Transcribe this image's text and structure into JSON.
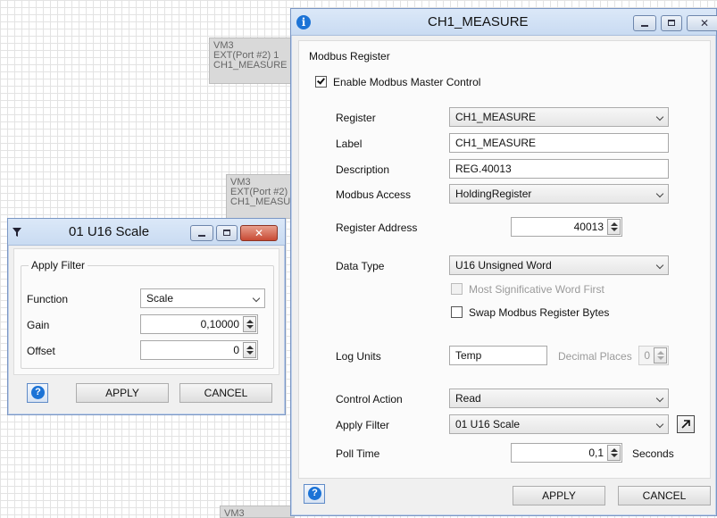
{
  "canvas": {
    "nodes": [
      {
        "lines": [
          "VM3",
          "EXT(Port #2) 1",
          "CH1_MEASURE"
        ]
      },
      {
        "lines": [
          "VM3",
          "EXT(Port #2)",
          "CH1_MEASU"
        ]
      },
      {
        "lines": [
          "VM3"
        ]
      }
    ]
  },
  "filter_window": {
    "title": "01 U16 Scale",
    "icon": "funnel-icon",
    "group_title": "Apply Filter",
    "function": {
      "label": "Function",
      "value": "Scale"
    },
    "gain": {
      "label": "Gain",
      "value": "0,10000"
    },
    "offset": {
      "label": "Offset",
      "value": "0"
    },
    "buttons": {
      "apply": "APPLY",
      "cancel": "CANCEL"
    }
  },
  "main_window": {
    "title": "CH1_MEASURE",
    "icon": "info-icon",
    "group_title": "Modbus Register",
    "enable_master": {
      "label": "Enable Modbus Master Control",
      "checked": true
    },
    "register": {
      "label": "Register",
      "value": "CH1_MEASURE"
    },
    "label_field": {
      "label": "Label",
      "value": "CH1_MEASURE"
    },
    "description": {
      "label": "Description",
      "value": "REG.40013"
    },
    "modbus_access": {
      "label": "Modbus Access",
      "value": "HoldingRegister"
    },
    "register_address": {
      "label": "Register Address",
      "value": "40013"
    },
    "data_type": {
      "label": "Data Type",
      "value": "U16 Unsigned Word"
    },
    "msw_first": {
      "label": "Most Significative Word First",
      "checked": false,
      "enabled": false
    },
    "swap_bytes": {
      "label": "Swap Modbus Register Bytes",
      "checked": false
    },
    "log_units": {
      "label": "Log Units",
      "value": "Temp"
    },
    "decimal_places": {
      "label": "Decimal Places",
      "value": "0"
    },
    "control_action": {
      "label": "Control Action",
      "value": "Read"
    },
    "apply_filter": {
      "label": "Apply Filter",
      "value": "01 U16 Scale"
    },
    "poll_time": {
      "label": "Poll Time",
      "value": "0,1",
      "unit": "Seconds"
    },
    "buttons": {
      "apply": "APPLY",
      "cancel": "CANCEL"
    }
  }
}
